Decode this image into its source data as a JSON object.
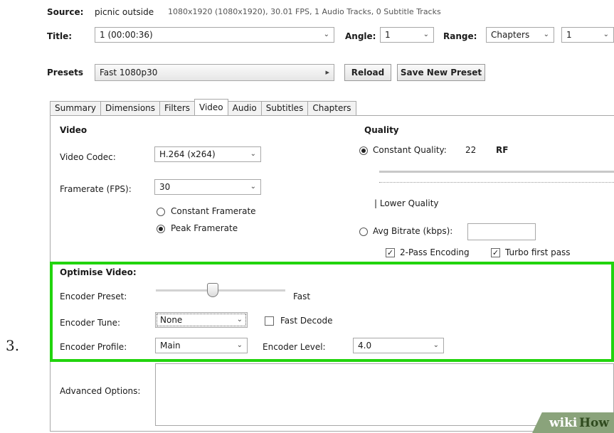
{
  "step_number": "3.",
  "source": {
    "label": "Source:",
    "name": "picnic outside",
    "info": "1080x1920 (1080x1920), 30.01 FPS, 1 Audio Tracks, 0 Subtitle Tracks"
  },
  "title": {
    "label": "Title:",
    "value": "1 (00:00:36)"
  },
  "angle": {
    "label": "Angle:",
    "value": "1"
  },
  "range": {
    "label": "Range:",
    "mode": "Chapters",
    "value": "1"
  },
  "presets": {
    "label": "Presets",
    "value": "Fast 1080p30",
    "arrow": "▸",
    "reload": "Reload",
    "save": "Save New Preset"
  },
  "tabs": [
    "Summary",
    "Dimensions",
    "Filters",
    "Video",
    "Audio",
    "Subtitles",
    "Chapters"
  ],
  "active_tab": "Video",
  "video": {
    "section": "Video",
    "codec_label": "Video Codec:",
    "codec_value": "H.264 (x264)",
    "fps_label": "Framerate (FPS):",
    "fps_value": "30",
    "constant_fr": "Constant Framerate",
    "peak_fr": "Peak Framerate"
  },
  "quality": {
    "section": "Quality",
    "cq_label": "Constant Quality:",
    "cq_value": "22",
    "cq_unit": "RF",
    "lower_quality": "| Lower Quality",
    "avg_bitrate": "Avg Bitrate (kbps):",
    "two_pass": "2-Pass Encoding",
    "turbo": "Turbo first pass"
  },
  "optimise": {
    "section": "Optimise Video:",
    "preset_label": "Encoder Preset:",
    "preset_value": "Fast",
    "tune_label": "Encoder Tune:",
    "tune_value": "None",
    "fast_decode": "Fast Decode",
    "profile_label": "Encoder Profile:",
    "profile_value": "Main",
    "level_label": "Encoder Level:",
    "level_value": "4.0"
  },
  "advanced": {
    "label": "Advanced Options:"
  },
  "watermark": {
    "wiki": "wiki",
    "how": "How"
  },
  "colors": {
    "highlight": "#22d40e",
    "watermark_bg": "#8aa37b"
  }
}
